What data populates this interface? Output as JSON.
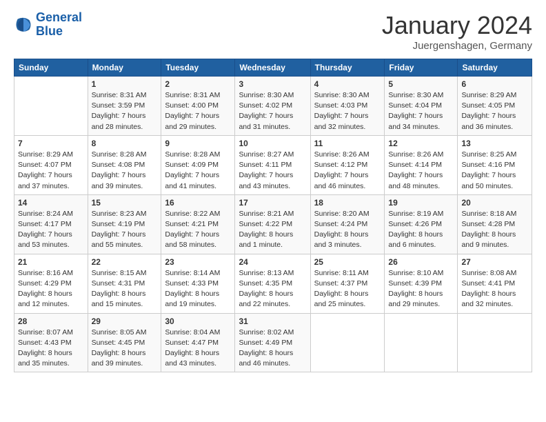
{
  "logo": {
    "line1": "General",
    "line2": "Blue"
  },
  "title": "January 2024",
  "location": "Juergenshagen, Germany",
  "weekdays": [
    "Sunday",
    "Monday",
    "Tuesday",
    "Wednesday",
    "Thursday",
    "Friday",
    "Saturday"
  ],
  "weeks": [
    [
      {
        "day": "",
        "info": ""
      },
      {
        "day": "1",
        "info": "Sunrise: 8:31 AM\nSunset: 3:59 PM\nDaylight: 7 hours\nand 28 minutes."
      },
      {
        "day": "2",
        "info": "Sunrise: 8:31 AM\nSunset: 4:00 PM\nDaylight: 7 hours\nand 29 minutes."
      },
      {
        "day": "3",
        "info": "Sunrise: 8:30 AM\nSunset: 4:02 PM\nDaylight: 7 hours\nand 31 minutes."
      },
      {
        "day": "4",
        "info": "Sunrise: 8:30 AM\nSunset: 4:03 PM\nDaylight: 7 hours\nand 32 minutes."
      },
      {
        "day": "5",
        "info": "Sunrise: 8:30 AM\nSunset: 4:04 PM\nDaylight: 7 hours\nand 34 minutes."
      },
      {
        "day": "6",
        "info": "Sunrise: 8:29 AM\nSunset: 4:05 PM\nDaylight: 7 hours\nand 36 minutes."
      }
    ],
    [
      {
        "day": "7",
        "info": "Sunrise: 8:29 AM\nSunset: 4:07 PM\nDaylight: 7 hours\nand 37 minutes."
      },
      {
        "day": "8",
        "info": "Sunrise: 8:28 AM\nSunset: 4:08 PM\nDaylight: 7 hours\nand 39 minutes."
      },
      {
        "day": "9",
        "info": "Sunrise: 8:28 AM\nSunset: 4:09 PM\nDaylight: 7 hours\nand 41 minutes."
      },
      {
        "day": "10",
        "info": "Sunrise: 8:27 AM\nSunset: 4:11 PM\nDaylight: 7 hours\nand 43 minutes."
      },
      {
        "day": "11",
        "info": "Sunrise: 8:26 AM\nSunset: 4:12 PM\nDaylight: 7 hours\nand 46 minutes."
      },
      {
        "day": "12",
        "info": "Sunrise: 8:26 AM\nSunset: 4:14 PM\nDaylight: 7 hours\nand 48 minutes."
      },
      {
        "day": "13",
        "info": "Sunrise: 8:25 AM\nSunset: 4:16 PM\nDaylight: 7 hours\nand 50 minutes."
      }
    ],
    [
      {
        "day": "14",
        "info": "Sunrise: 8:24 AM\nSunset: 4:17 PM\nDaylight: 7 hours\nand 53 minutes."
      },
      {
        "day": "15",
        "info": "Sunrise: 8:23 AM\nSunset: 4:19 PM\nDaylight: 7 hours\nand 55 minutes."
      },
      {
        "day": "16",
        "info": "Sunrise: 8:22 AM\nSunset: 4:21 PM\nDaylight: 7 hours\nand 58 minutes."
      },
      {
        "day": "17",
        "info": "Sunrise: 8:21 AM\nSunset: 4:22 PM\nDaylight: 8 hours\nand 1 minute."
      },
      {
        "day": "18",
        "info": "Sunrise: 8:20 AM\nSunset: 4:24 PM\nDaylight: 8 hours\nand 3 minutes."
      },
      {
        "day": "19",
        "info": "Sunrise: 8:19 AM\nSunset: 4:26 PM\nDaylight: 8 hours\nand 6 minutes."
      },
      {
        "day": "20",
        "info": "Sunrise: 8:18 AM\nSunset: 4:28 PM\nDaylight: 8 hours\nand 9 minutes."
      }
    ],
    [
      {
        "day": "21",
        "info": "Sunrise: 8:16 AM\nSunset: 4:29 PM\nDaylight: 8 hours\nand 12 minutes."
      },
      {
        "day": "22",
        "info": "Sunrise: 8:15 AM\nSunset: 4:31 PM\nDaylight: 8 hours\nand 15 minutes."
      },
      {
        "day": "23",
        "info": "Sunrise: 8:14 AM\nSunset: 4:33 PM\nDaylight: 8 hours\nand 19 minutes."
      },
      {
        "day": "24",
        "info": "Sunrise: 8:13 AM\nSunset: 4:35 PM\nDaylight: 8 hours\nand 22 minutes."
      },
      {
        "day": "25",
        "info": "Sunrise: 8:11 AM\nSunset: 4:37 PM\nDaylight: 8 hours\nand 25 minutes."
      },
      {
        "day": "26",
        "info": "Sunrise: 8:10 AM\nSunset: 4:39 PM\nDaylight: 8 hours\nand 29 minutes."
      },
      {
        "day": "27",
        "info": "Sunrise: 8:08 AM\nSunset: 4:41 PM\nDaylight: 8 hours\nand 32 minutes."
      }
    ],
    [
      {
        "day": "28",
        "info": "Sunrise: 8:07 AM\nSunset: 4:43 PM\nDaylight: 8 hours\nand 35 minutes."
      },
      {
        "day": "29",
        "info": "Sunrise: 8:05 AM\nSunset: 4:45 PM\nDaylight: 8 hours\nand 39 minutes."
      },
      {
        "day": "30",
        "info": "Sunrise: 8:04 AM\nSunset: 4:47 PM\nDaylight: 8 hours\nand 43 minutes."
      },
      {
        "day": "31",
        "info": "Sunrise: 8:02 AM\nSunset: 4:49 PM\nDaylight: 8 hours\nand 46 minutes."
      },
      {
        "day": "",
        "info": ""
      },
      {
        "day": "",
        "info": ""
      },
      {
        "day": "",
        "info": ""
      }
    ]
  ]
}
